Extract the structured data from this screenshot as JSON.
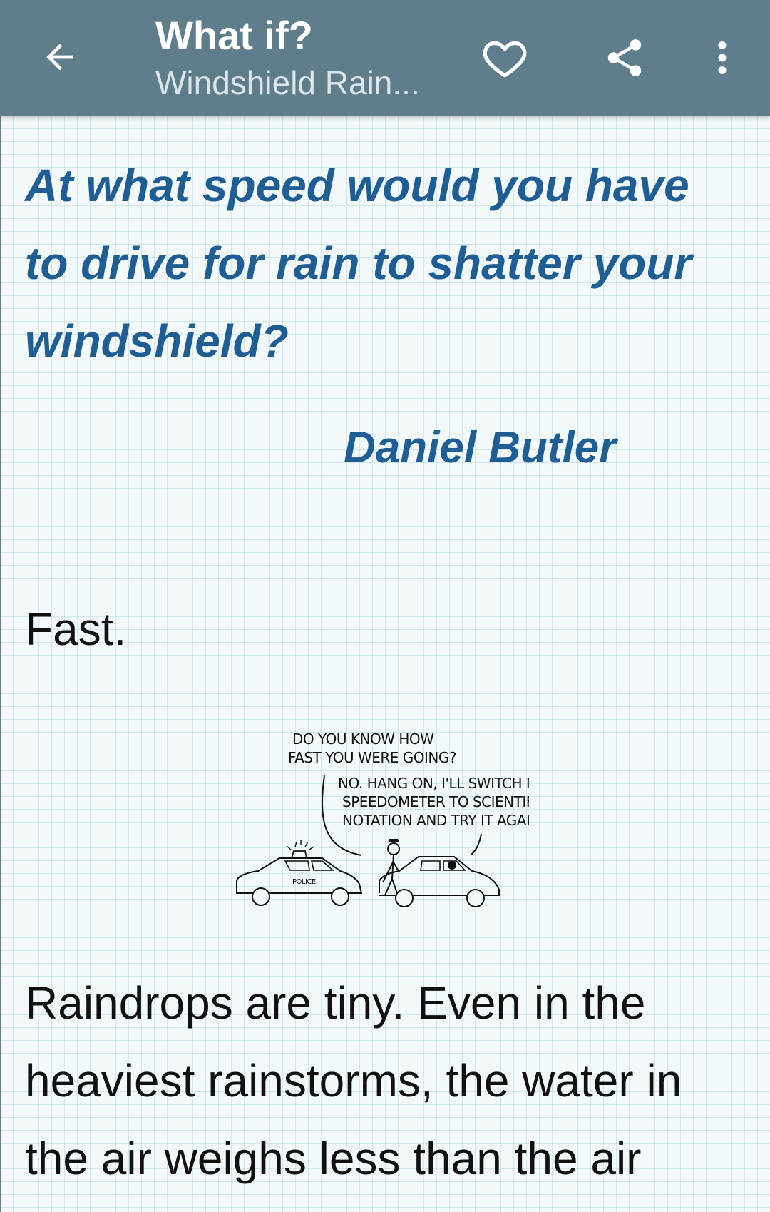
{
  "appbar": {
    "title": "What if?",
    "subtitle": "Windshield Rain...",
    "back_icon": "arrow-left-icon",
    "favorite_icon": "heart-icon",
    "share_icon": "share-icon",
    "more_icon": "more-vertical-icon",
    "color": "#607d8b"
  },
  "article": {
    "question": "At what speed would you have to drive for rain to shatter your windshield?",
    "author": "Daniel Butler",
    "answer": "Fast.",
    "comic": {
      "officer_line1": "DO YOU KNOW HOW",
      "officer_line2": "FAST YOU WERE GOING?",
      "driver_line1": "NO. HANG ON, I'LL SWITCH MY",
      "driver_line2": "SPEEDOMETER TO SCIENTIFIC",
      "driver_line3": "NOTATION AND TRY IT AGAIN.",
      "car_label": "POLICE"
    },
    "body": "Raindrops are tiny. Even in the heaviest rainstorms, the water in the air weighs less than the air"
  },
  "colors": {
    "question_text": "#1e5e94",
    "body_text": "#111111",
    "background": "#f3f9fa"
  }
}
